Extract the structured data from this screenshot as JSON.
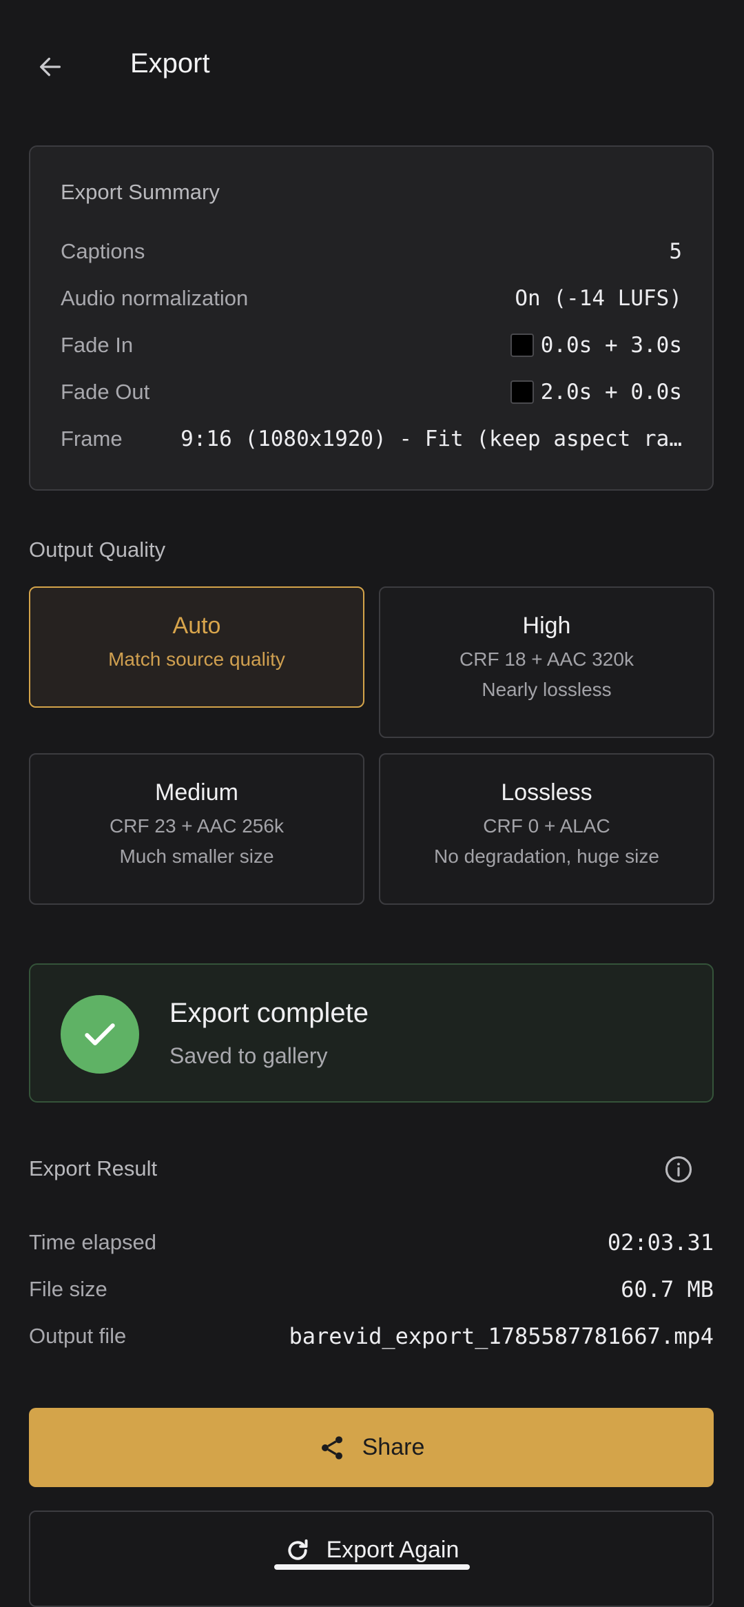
{
  "header": {
    "title": "Export",
    "back_icon": "arrow-left-icon"
  },
  "summary": {
    "heading": "Export Summary",
    "rows": [
      {
        "label": "Captions",
        "value": "5"
      },
      {
        "label": "Audio normalization",
        "value": "On (-14 LUFS)"
      },
      {
        "label": "Fade In",
        "value": "0.0s + 3.0s",
        "swatch_color": "#000000"
      },
      {
        "label": "Fade Out",
        "value": "2.0s + 0.0s",
        "swatch_color": "#000000"
      },
      {
        "label": "Frame",
        "value": "9:16 (1080x1920) - Fit (keep aspect ra…"
      }
    ]
  },
  "quality": {
    "label": "Output Quality",
    "selected": "Auto",
    "options": [
      {
        "title": "Auto",
        "line1": "Match source quality",
        "line2": ""
      },
      {
        "title": "High",
        "line1": "CRF 18 + AAC 320k",
        "line2": "Nearly lossless"
      },
      {
        "title": "Medium",
        "line1": "CRF 23 + AAC 256k",
        "line2": "Much smaller size"
      },
      {
        "title": "Lossless",
        "line1": "CRF 0 + ALAC",
        "line2": "No degradation, huge size"
      }
    ]
  },
  "status": {
    "title": "Export complete",
    "subtitle": "Saved to gallery",
    "icon": "check-icon",
    "color": "#5fb265"
  },
  "result": {
    "heading": "Export Result",
    "info_icon": "info-icon",
    "rows": [
      {
        "label": "Time elapsed",
        "value": "02:03.31"
      },
      {
        "label": "File size",
        "value": "60.7 MB"
      },
      {
        "label": "Output file",
        "value": "barevid_export_1785587781667.mp4"
      }
    ]
  },
  "actions": {
    "share_label": "Share",
    "share_icon": "share-icon",
    "export_again_label": "Export Again",
    "export_again_icon": "refresh-icon"
  },
  "colors": {
    "accent": "#d4a44a",
    "background": "#18181a",
    "success": "#5fb265"
  }
}
